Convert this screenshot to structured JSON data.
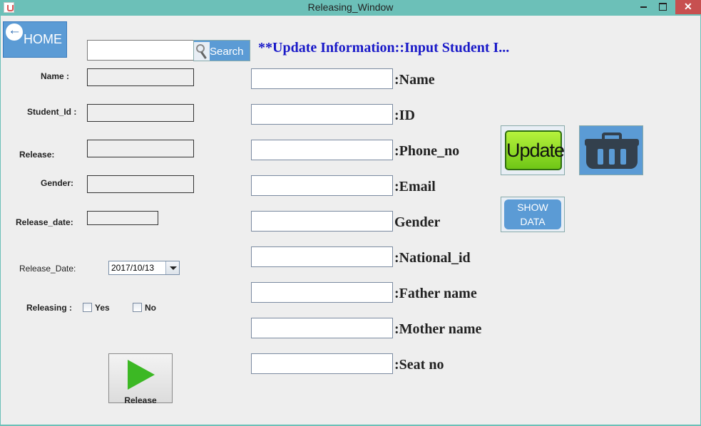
{
  "window": {
    "title": "Releasing_Window"
  },
  "home_button": {
    "label": "HOME"
  },
  "search": {
    "value": "",
    "button_label": "Search"
  },
  "heading": "**Update Information::Input Student  I...",
  "left_panel": {
    "name_label": "Name :",
    "student_id_label": "Student_Id :",
    "release_label": "Release:",
    "gender_label": "Gender:",
    "release_date_label_1": "Release_date:",
    "release_date_label_2": "Release_Date:",
    "release_date_value": "2017/10/13",
    "releasing_label": "Releasing :",
    "yes_label": "Yes",
    "no_label": "No",
    "release_button_label": "Release"
  },
  "form": {
    "name_label": ":Name",
    "id_label": ":ID",
    "phone_label": ":Phone_no",
    "email_label": ":Email",
    "gender_label": "Gender",
    "national_id_label": ":National_id",
    "father_label": ":Father name",
    "mother_label": ":Mother name",
    "seat_label": ":Seat no"
  },
  "actions": {
    "update_label": "Update",
    "show_data_line1": "SHOW",
    "show_data_line2": "DATA"
  },
  "colors": {
    "titlebar": "#6cc0b8",
    "accent_blue": "#5b9bd5",
    "heading_blue": "#1919c8",
    "update_green": "#6fc616",
    "release_green": "#3cb824",
    "close_red": "#c75050"
  },
  "icons": {
    "home": "arrow-left-icon",
    "search": "magnifier-icon",
    "release": "play-icon",
    "delete": "trash-bin-icon"
  }
}
